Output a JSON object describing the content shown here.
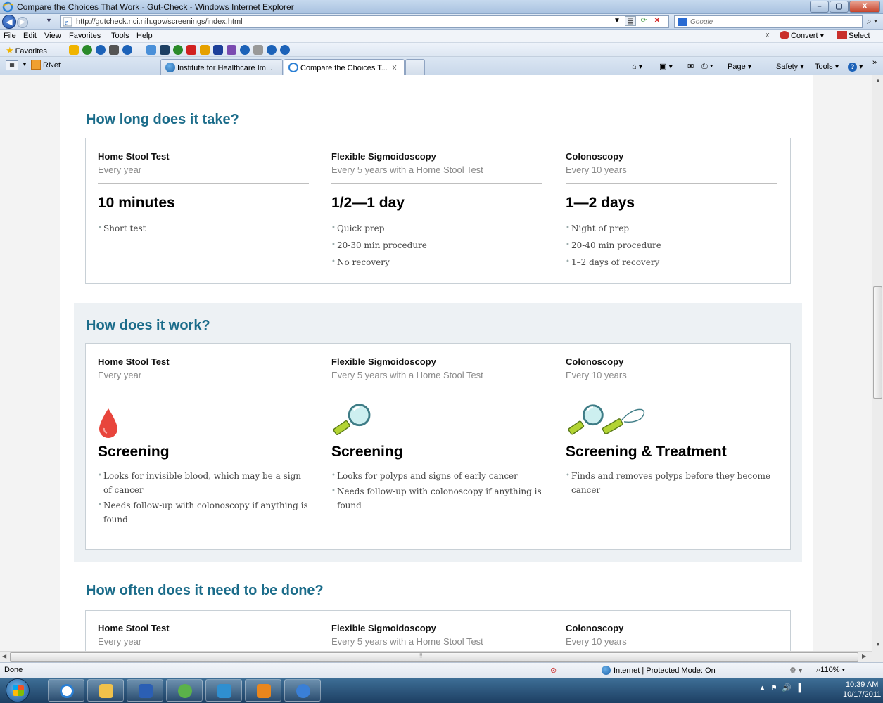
{
  "window": {
    "title": "Compare the Choices That Work - Gut-Check - Windows Internet Explorer",
    "min": "–",
    "max": "▢",
    "close": "X"
  },
  "address": {
    "url": "http://gutcheck.nci.nih.gov/screenings/index.html",
    "search_placeholder": "Google"
  },
  "menu": {
    "items": [
      "File",
      "Edit",
      "View",
      "Favorites",
      "Tools",
      "Help"
    ],
    "close": "x",
    "convert": "Convert",
    "select": "Select"
  },
  "favorites": {
    "label": "Favorites"
  },
  "tabs": {
    "group": "RNet",
    "items": [
      {
        "label": "Institute for Healthcare Im..."
      },
      {
        "label": "Compare the Choices T..."
      }
    ],
    "tab_close": "X"
  },
  "commands": {
    "page": "Page",
    "safety": "Safety",
    "tools": "Tools"
  },
  "columns_header": {
    "hst_name": "Home Stool Test",
    "hst_freq": "Every year",
    "flex_name": "Flexible Sigmoidoscopy",
    "flex_freq": "Every 5 years with a Home Stool Test",
    "colo_name": "Colonoscopy",
    "colo_freq": "Every 10 years"
  },
  "sections": {
    "take": {
      "title": "How long does it take?",
      "hst": {
        "big": "10 minutes",
        "bullets": [
          "Short test"
        ]
      },
      "flex": {
        "big": "1/2—1 day",
        "bullets": [
          "Quick prep",
          "20-30 min procedure",
          "No recovery"
        ]
      },
      "colo": {
        "big": "1—2 days",
        "bullets": [
          "Night of prep",
          "20-40 min procedure",
          "1–2 days of recovery"
        ]
      }
    },
    "work": {
      "title": "How does it work?",
      "hst": {
        "big": "Screening",
        "bullets": [
          "Looks for invisible blood, which may be a sign of cancer",
          "Needs follow-up with colonoscopy if anything is found"
        ]
      },
      "flex": {
        "big": "Screening",
        "bullets": [
          "Looks for polyps and signs of early cancer",
          "Needs follow-up with colonoscopy if anything is found"
        ]
      },
      "colo": {
        "big": "Screening & Treatment",
        "bullets": [
          "Finds and removes polyps before they become cancer"
        ]
      }
    },
    "often": {
      "title": "How often does it need to be done?"
    }
  },
  "status": {
    "text": "Done",
    "zone": "Internet | Protected Mode: On",
    "zoom": "110%"
  },
  "clock": {
    "time": "10:39 AM",
    "date": "10/17/2011"
  }
}
